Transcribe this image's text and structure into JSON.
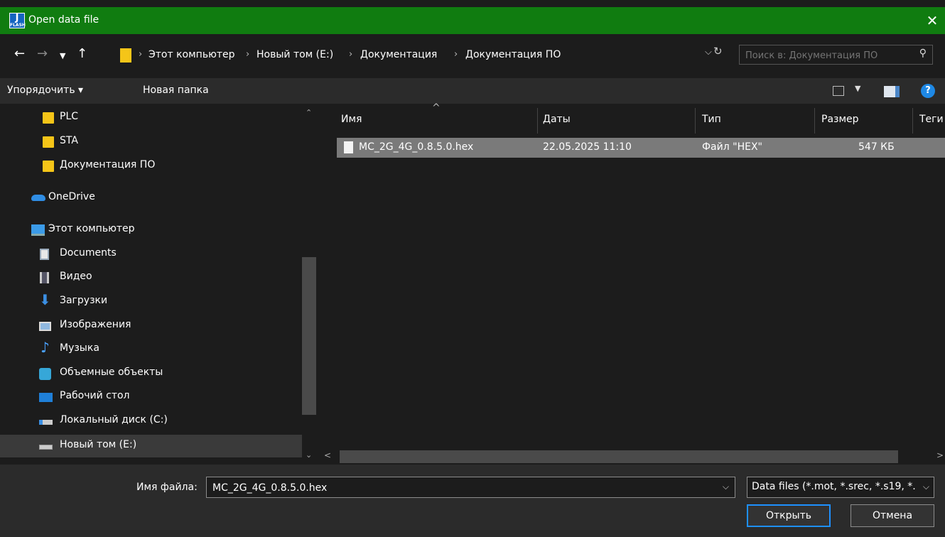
{
  "window": {
    "title": "Open data file",
    "app_icon_text": "J",
    "app_icon_sub": "FLASH"
  },
  "address": {
    "crumbs": [
      "Этот компьютер",
      "Новый том (E:)",
      "Документация",
      "Документация ПО"
    ],
    "separator": "›"
  },
  "search": {
    "placeholder": "Поиск в: Документация ПО"
  },
  "toolbar": {
    "organize": "Упорядочить ▾",
    "new_folder": "Новая папка",
    "help": "?"
  },
  "nav": {
    "items": [
      {
        "label": "PLC",
        "icon": "folder-icon"
      },
      {
        "label": "STA",
        "icon": "folder-icon"
      },
      {
        "label": "Документация ПО",
        "icon": "folder-icon"
      },
      {
        "label": "OneDrive",
        "icon": "cloud-icon"
      },
      {
        "label": "Этот компьютер",
        "icon": "computer-icon"
      },
      {
        "label": "Documents",
        "icon": "documents-icon"
      },
      {
        "label": "Видео",
        "icon": "video-icon"
      },
      {
        "label": "Загрузки",
        "icon": "download-icon"
      },
      {
        "label": "Изображения",
        "icon": "pictures-icon"
      },
      {
        "label": "Музыка",
        "icon": "music-icon"
      },
      {
        "label": "Объемные объекты",
        "icon": "3d-objects-icon"
      },
      {
        "label": "Рабочий стол",
        "icon": "desktop-icon"
      },
      {
        "label": "Локальный диск (C:)",
        "icon": "drive-icon"
      },
      {
        "label": "Новый том (E:)",
        "icon": "drive-icon"
      }
    ]
  },
  "columns": {
    "name": "Имя",
    "date": "Даты",
    "type": "Тип",
    "size": "Размер",
    "tags": "Теги"
  },
  "files": [
    {
      "name": "MC_2G_4G_0.8.5.0.hex",
      "date": "22.05.2025 11:10",
      "type": "Файл \"HEX\"",
      "size": "547 КБ"
    }
  ],
  "bottom": {
    "filename_label": "Имя файла:",
    "filename_value": "MC_2G_4G_0.8.5.0.hex",
    "filter": "Data files (*.mot, *.srec, *.s19, *.",
    "open": "Открыть",
    "cancel": "Отмена"
  },
  "colors": {
    "titlebar": "#107c10",
    "background": "#1c1c1c",
    "toolbar": "#2b2b2b",
    "selection": "#7a7a7a",
    "accent": "#1e90ff"
  }
}
